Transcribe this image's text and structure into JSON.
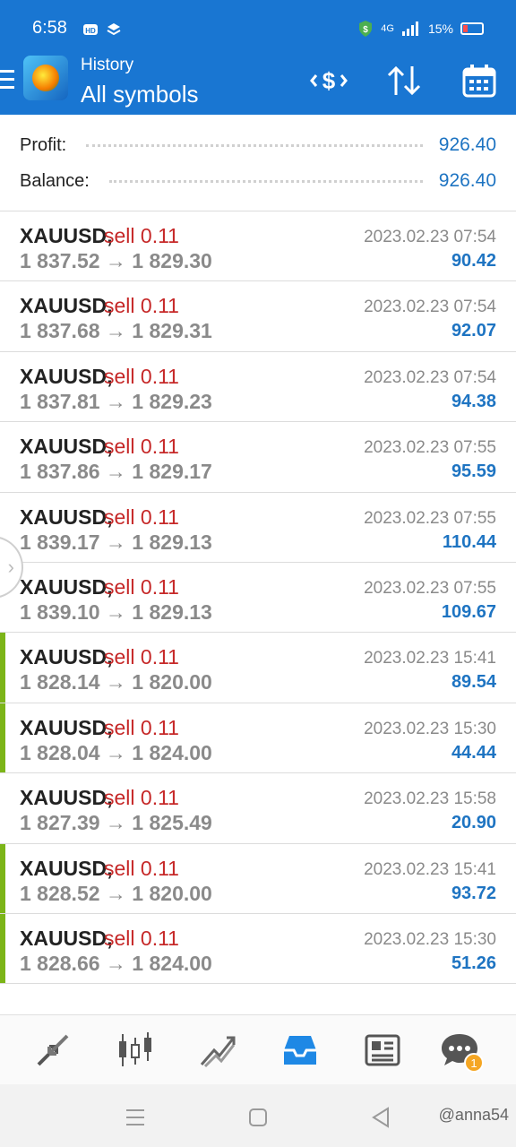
{
  "status_bar": {
    "time": "6:58",
    "network": "4G",
    "battery_pct": "15%"
  },
  "header": {
    "subtitle": "History",
    "title": "All symbols"
  },
  "summary": {
    "profit_label": "Profit:",
    "profit_value": "926.40",
    "balance_label": "Balance:",
    "balance_value": "926.40"
  },
  "deals": [
    {
      "symbol": "XAUUSD,",
      "side": "sell 0.11",
      "prices": "1 837.52 → 1 829.30",
      "datetime": "2023.02.23 07:54",
      "profit": "90.42"
    },
    {
      "symbol": "XAUUSD,",
      "side": "sell 0.11",
      "prices": "1 837.68 → 1 829.31",
      "datetime": "2023.02.23 07:54",
      "profit": "92.07"
    },
    {
      "symbol": "XAUUSD,",
      "side": "sell 0.11",
      "prices": "1 837.81 → 1 829.23",
      "datetime": "2023.02.23 07:54",
      "profit": "94.38"
    },
    {
      "symbol": "XAUUSD,",
      "side": "sell 0.11",
      "prices": "1 837.86 → 1 829.17",
      "datetime": "2023.02.23 07:55",
      "profit": "95.59"
    },
    {
      "symbol": "XAUUSD,",
      "side": "sell 0.11",
      "prices": "1 839.17 → 1 829.13",
      "datetime": "2023.02.23 07:55",
      "profit": "110.44"
    },
    {
      "symbol": "XAUUSD,",
      "side": "sell 0.11",
      "prices": "1 839.10 → 1 829.13",
      "datetime": "2023.02.23 07:55",
      "profit": "109.67"
    },
    {
      "symbol": "XAUUSD,",
      "side": "sell 0.11",
      "prices": "1 828.14 → 1 820.00",
      "datetime": "2023.02.23 15:41",
      "profit": "89.54"
    },
    {
      "symbol": "XAUUSD,",
      "side": "sell 0.11",
      "prices": "1 828.04 → 1 824.00",
      "datetime": "2023.02.23 15:30",
      "profit": "44.44"
    },
    {
      "symbol": "XAUUSD,",
      "side": "sell 0.11",
      "prices": "1 827.39 → 1 825.49",
      "datetime": "2023.02.23 15:58",
      "profit": "20.90"
    },
    {
      "symbol": "XAUUSD,",
      "side": "sell 0.11",
      "prices": "1 828.52 → 1 820.00",
      "datetime": "2023.02.23 15:41",
      "profit": "93.72"
    },
    {
      "symbol": "XAUUSD,",
      "side": "sell 0.11",
      "prices": "1 828.66 → 1 824.00",
      "datetime": "2023.02.23 15:30",
      "profit": "51.26"
    }
  ],
  "bottom_nav": {
    "items": [
      "quotes-icon",
      "chart-icon",
      "trade-icon",
      "history-icon",
      "news-icon",
      "chat-icon"
    ],
    "active": "history-icon",
    "chat_badge": "1"
  },
  "watermark": "@anna54",
  "colors": {
    "header_blue": "#1976d2",
    "sell_red": "#c62828",
    "profit_blue": "#1e74c2",
    "marker_green": "#7cb518"
  }
}
